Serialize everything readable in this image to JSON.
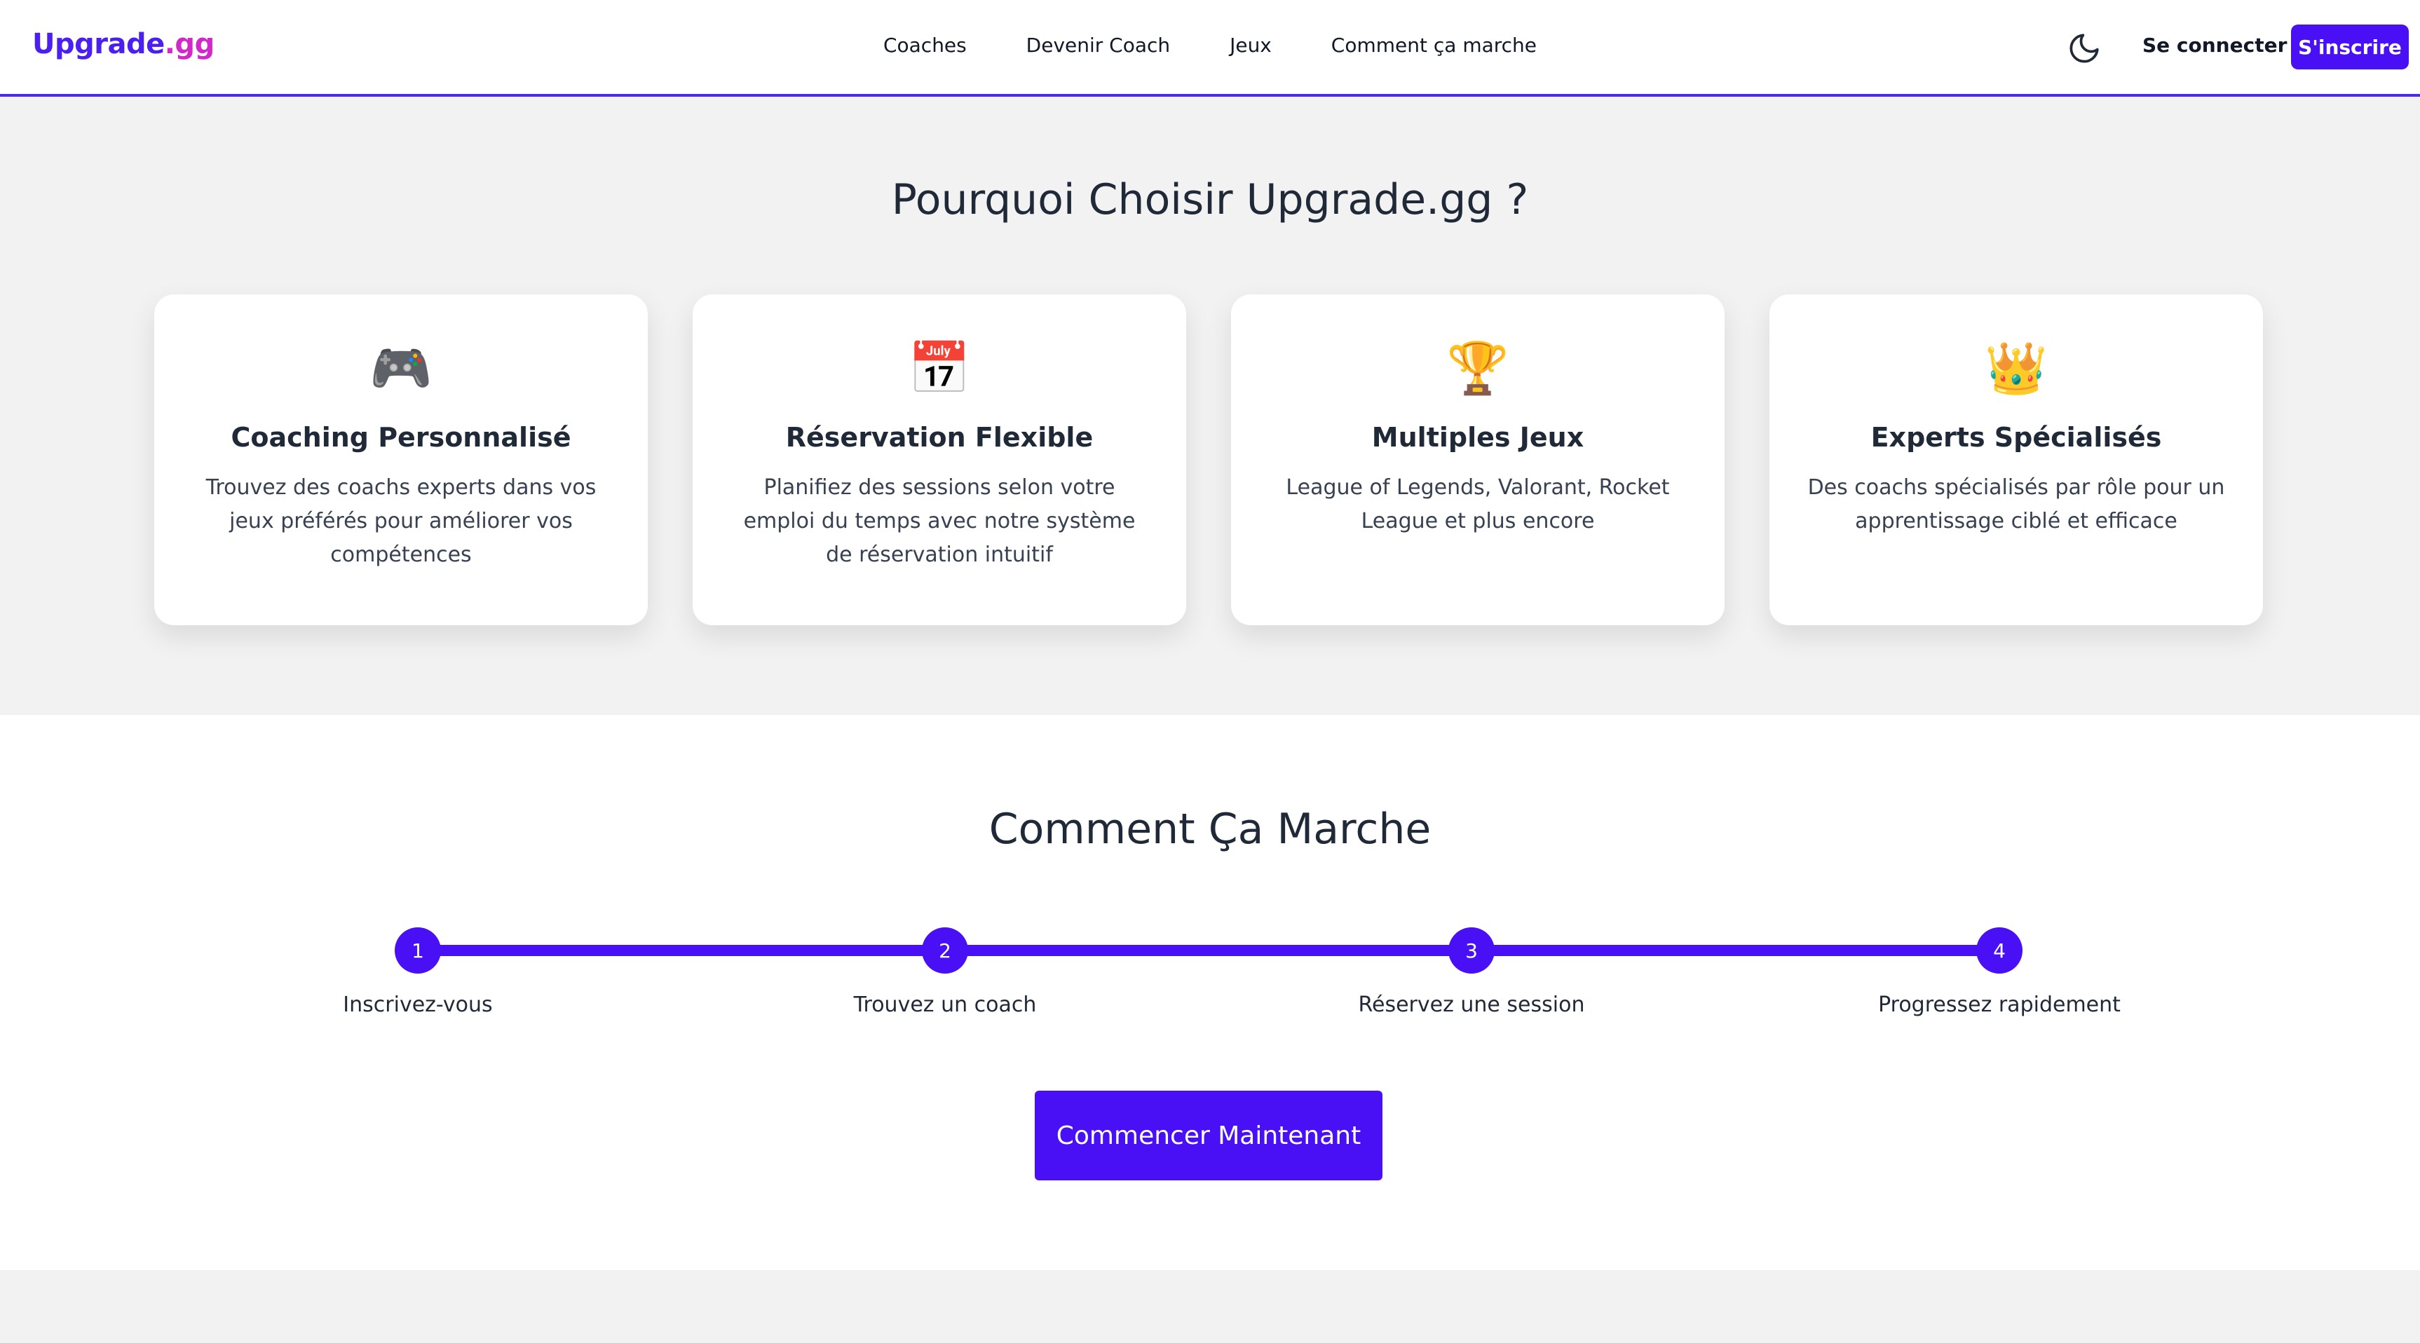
{
  "header": {
    "logo_part1": "Upgrade",
    "logo_part2": ".gg",
    "nav": [
      "Coaches",
      "Devenir Coach",
      "Jeux",
      "Comment ça marche"
    ],
    "theme_icon": "moon-icon",
    "login_label": "Se connecter",
    "signup_label": "S'inscrire"
  },
  "why": {
    "title": "Pourquoi Choisir Upgrade.gg ?",
    "cards": [
      {
        "icon": "🎮",
        "icon_name": "gamepad-icon",
        "title": "Coaching Personnalisé",
        "desc": "Trouvez des coachs experts dans vos jeux préférés pour améliorer vos compétences"
      },
      {
        "icon": "📅",
        "icon_name": "calendar-icon",
        "title": "Réservation Flexible",
        "desc": "Planifiez des sessions selon votre emploi du temps avec notre système de réservation intuitif"
      },
      {
        "icon": "🏆",
        "icon_name": "trophy-icon",
        "title": "Multiples Jeux",
        "desc": "League of Legends, Valorant, Rocket League et plus encore"
      },
      {
        "icon": "👑",
        "icon_name": "crown-icon",
        "title": "Experts Spécialisés",
        "desc": "Des coachs spécialisés par rôle pour un apprentissage ciblé et efficace"
      }
    ]
  },
  "how": {
    "title": "Comment Ça Marche",
    "steps": [
      {
        "num": "1",
        "label": "Inscrivez-vous"
      },
      {
        "num": "2",
        "label": "Trouvez un coach"
      },
      {
        "num": "3",
        "label": "Réservez une session"
      },
      {
        "num": "4",
        "label": "Progressez rapidement"
      }
    ],
    "cta_label": "Commencer Maintenant"
  },
  "colors": {
    "accent": "#4a10f5",
    "logo_primary": "#4a1ff0",
    "logo_secondary": "#d328c9",
    "page_bg": "#f2f2f2"
  }
}
